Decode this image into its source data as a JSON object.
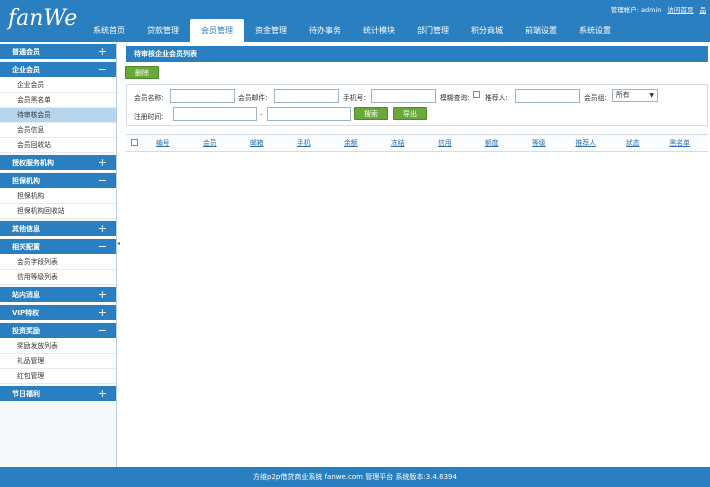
{
  "header": {
    "logo": "fanWe",
    "top_links": {
      "user": "管理帐户: admin",
      "visit_home": "访问首页",
      "more": "品"
    },
    "nav": [
      {
        "label": "系统首页",
        "active": false
      },
      {
        "label": "贷款管理",
        "active": false
      },
      {
        "label": "会员管理",
        "active": true
      },
      {
        "label": "资金管理",
        "active": false
      },
      {
        "label": "待办事务",
        "active": false
      },
      {
        "label": "统计模块",
        "active": false
      },
      {
        "label": "部门管理",
        "active": false
      },
      {
        "label": "积分商城",
        "active": false
      },
      {
        "label": "前端设置",
        "active": false
      },
      {
        "label": "系统设置",
        "active": false
      }
    ]
  },
  "sidebar": {
    "groups": [
      {
        "title": "普通会员",
        "sign": "+",
        "items": []
      },
      {
        "title": "企业会员",
        "sign": "−",
        "items": [
          "企业会员",
          "会员黑名单",
          "待审核会员",
          "会员信息",
          "会员回收站"
        ]
      },
      {
        "title": "授权服务机构",
        "sign": "+",
        "items": []
      },
      {
        "title": "担保机构",
        "sign": "−",
        "items": [
          "担保机构",
          "担保机构回收站"
        ]
      },
      {
        "title": "其他信息",
        "sign": "+",
        "items": []
      },
      {
        "title": "相关配置",
        "sign": "−",
        "items": [
          "会员字段列表",
          "信用等级列表"
        ]
      },
      {
        "title": "站内消息",
        "sign": "+",
        "items": []
      },
      {
        "title": "VIP特权",
        "sign": "+",
        "items": []
      },
      {
        "title": "投资奖励",
        "sign": "−",
        "items": [
          "奖励发放列表",
          "礼品管理",
          "红包管理"
        ]
      },
      {
        "title": "节日福利",
        "sign": "+",
        "items": []
      }
    ],
    "selected_item": "待审核会员",
    "splitter": "◂"
  },
  "main": {
    "title": "待审核企业会员列表",
    "delete_label": "删除",
    "filters": {
      "member_name": "会员名称:",
      "member_email": "会员邮件:",
      "phone": "手机号:",
      "fuzzy": "模糊查询:",
      "referrer": "推荐人:",
      "group": "会员组:",
      "group_value": "所有",
      "reg_time": "注册时间:",
      "range_sep": "-",
      "search_label": "搜索",
      "export_label": "导出"
    },
    "columns": [
      "编号",
      "会员",
      "邮箱",
      "手机",
      "余额",
      "冻结",
      "信用",
      "额度",
      "等级",
      "推荐人",
      "状态",
      "黑名单"
    ]
  },
  "footer": {
    "text": "方维p2p借贷商业系统 fanwe.com 管理平台 系统版本:3.4.6394"
  }
}
